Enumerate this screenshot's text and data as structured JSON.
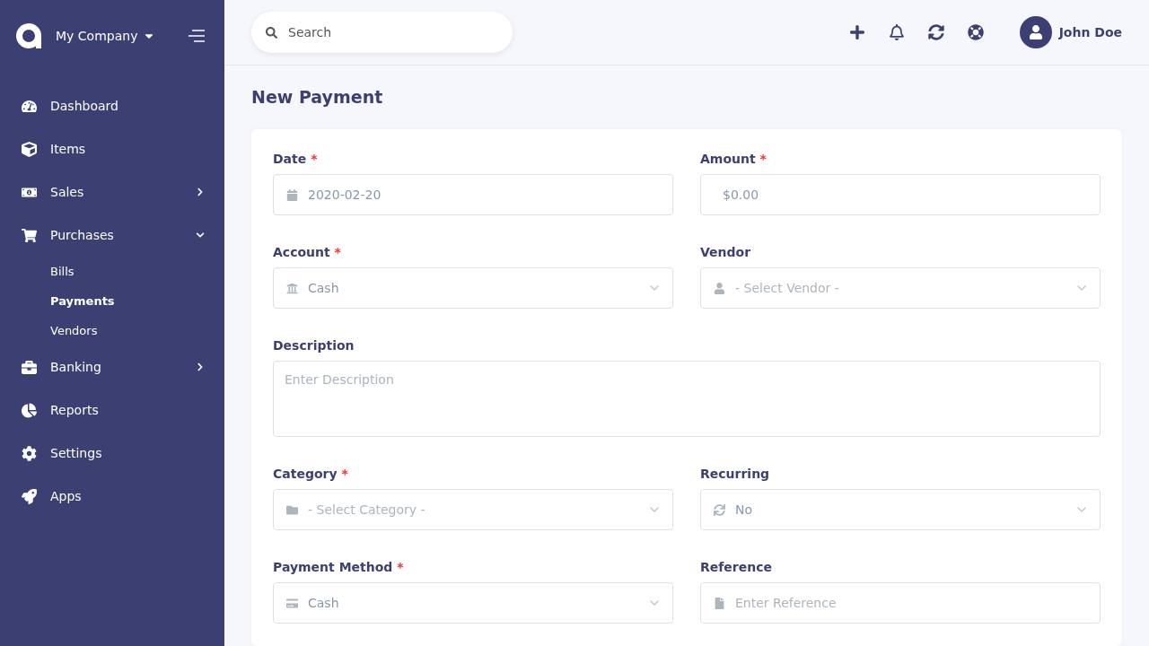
{
  "company": {
    "name": "My Company"
  },
  "sidebar": {
    "items": [
      {
        "label": "Dashboard"
      },
      {
        "label": "Items"
      },
      {
        "label": "Sales",
        "expanded": false
      },
      {
        "label": "Purchases",
        "expanded": true,
        "children": [
          {
            "label": "Bills",
            "selected": false
          },
          {
            "label": "Payments",
            "selected": true
          },
          {
            "label": "Vendors",
            "selected": false
          }
        ]
      },
      {
        "label": "Banking",
        "expanded": false
      },
      {
        "label": "Reports"
      },
      {
        "label": "Settings"
      },
      {
        "label": "Apps"
      }
    ]
  },
  "header": {
    "search": {
      "placeholder": "Search"
    },
    "user": {
      "name": "John Doe"
    }
  },
  "page": {
    "title": "New Payment"
  },
  "form": {
    "fields": [
      {
        "label": "Date",
        "required_mark": "*",
        "kind": "input",
        "value": "2020-02-20"
      },
      {
        "label": "Amount",
        "required_mark": "*",
        "kind": "input",
        "value": "$0.00"
      },
      {
        "label": "Account",
        "required_mark": "*",
        "kind": "select",
        "value": "Cash"
      },
      {
        "label": "Vendor",
        "kind": "select",
        "placeholder": "- Select Vendor -"
      },
      {
        "label": "Description",
        "kind": "textarea",
        "placeholder": "Enter Description"
      },
      {
        "label": "Category",
        "required_mark": "*",
        "kind": "select",
        "placeholder": "- Select Category -"
      },
      {
        "label": "Recurring",
        "kind": "select",
        "value": "No"
      },
      {
        "label": "Payment Method",
        "required_mark": "*",
        "kind": "select",
        "value": "Cash"
      },
      {
        "label": "Reference",
        "kind": "input",
        "placeholder": "Enter Reference"
      }
    ]
  }
}
